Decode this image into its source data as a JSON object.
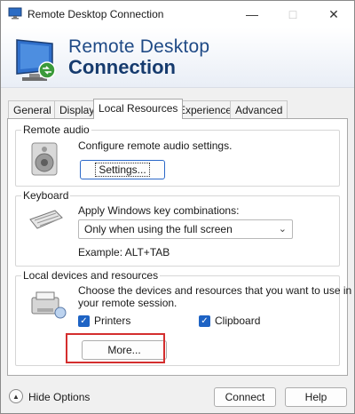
{
  "window": {
    "title": "Remote Desktop Connection"
  },
  "banner": {
    "line1": "Remote Desktop",
    "line2": "Connection"
  },
  "tabs": [
    {
      "label": "General"
    },
    {
      "label": "Display"
    },
    {
      "label": "Local Resources",
      "active": true
    },
    {
      "label": "Experience"
    },
    {
      "label": "Advanced"
    }
  ],
  "remote_audio": {
    "title": "Remote audio",
    "description": "Configure remote audio settings.",
    "settings_button": "Settings..."
  },
  "keyboard": {
    "title": "Keyboard",
    "description": "Apply Windows key combinations:",
    "selected_option": "Only when using the full screen",
    "example": "Example: ALT+TAB"
  },
  "local_devices": {
    "title": "Local devices and resources",
    "description_line1": "Choose the devices and resources that you want to use in",
    "description_line2": "your remote session.",
    "printers_label": "Printers",
    "printers_checked": true,
    "clipboard_label": "Clipboard",
    "clipboard_checked": true,
    "more_button": "More..."
  },
  "footer": {
    "hide_options": "Hide Options",
    "connect_button": "Connect",
    "help_button": "Help"
  },
  "colors": {
    "accent": "#1e63c4",
    "highlight": "#d42e2e",
    "banner_text": "#1f4a86"
  }
}
